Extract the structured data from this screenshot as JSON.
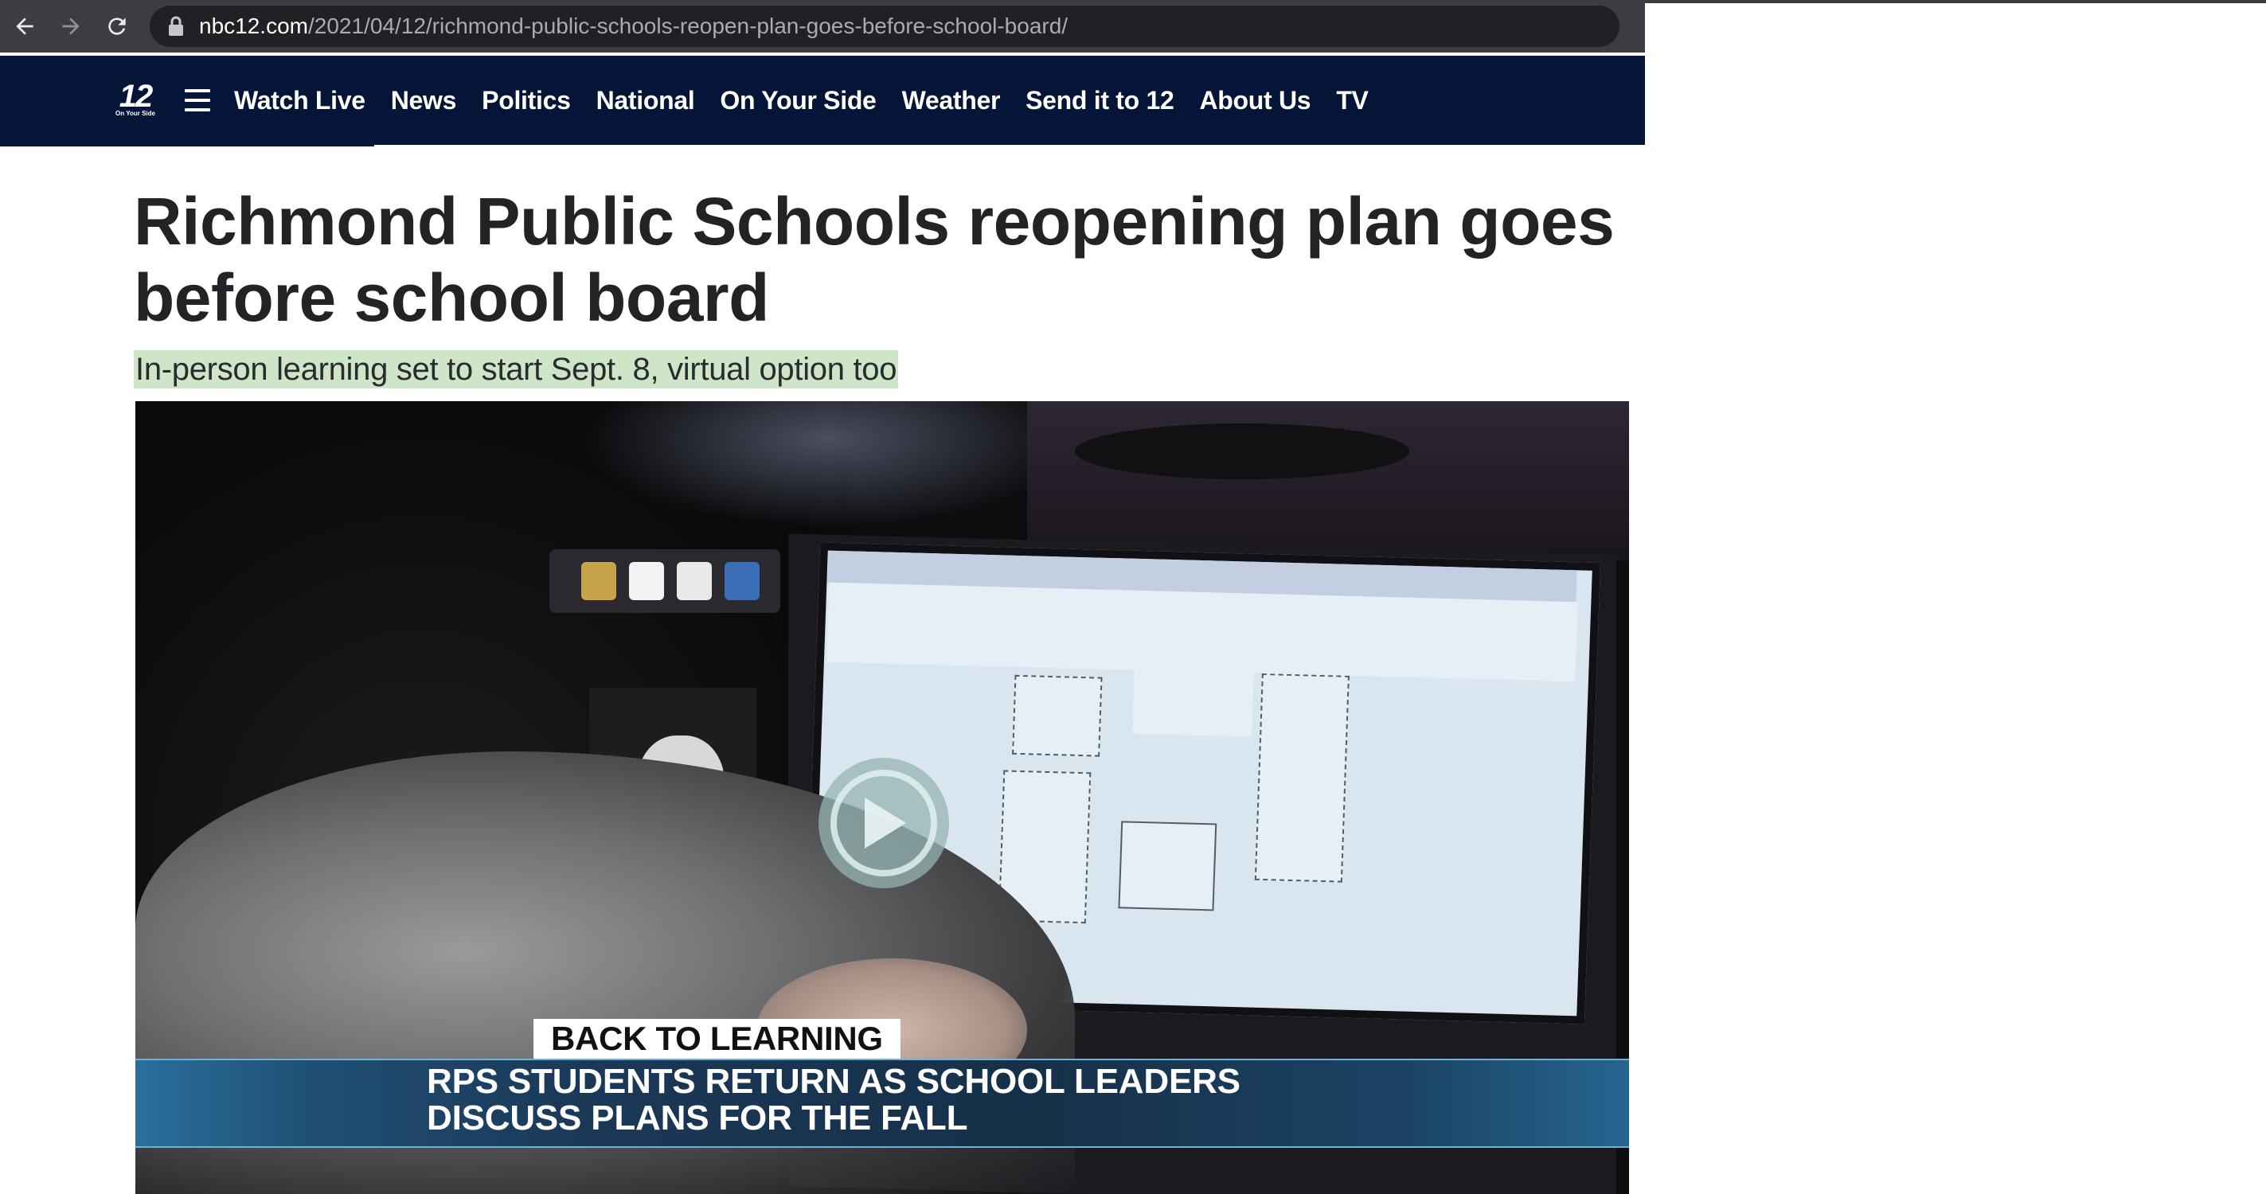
{
  "browser": {
    "url_domain": "nbc12.com",
    "url_path": "/2021/04/12/richmond-public-schools-reopen-plan-goes-before-school-board/"
  },
  "site": {
    "logo_number": "12",
    "logo_tagline": "On Your Side",
    "nav": [
      "Watch Live",
      "News",
      "Politics",
      "National",
      "On Your Side",
      "Weather",
      "Send it to 12",
      "About Us",
      "TV"
    ],
    "nav_color": "#041538"
  },
  "article": {
    "headline": "Richmond Public Schools reopening plan goes before school board",
    "subhead": "In-person learning set to start Sept. 8, virtual option too"
  },
  "video": {
    "label": "BACK TO LEARNING",
    "caption_line1": "RPS STUDENTS RETURN AS SCHOOL LEADERS",
    "caption_line2": "DISCUSS PLANS FOR THE FALL"
  }
}
